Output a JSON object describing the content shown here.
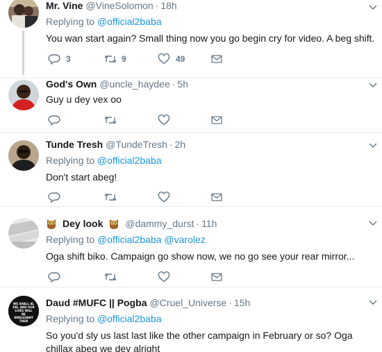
{
  "tweets": [
    {
      "name": "Mr. Vine",
      "handle": "@VineSolomon",
      "time": "18h",
      "replying_label": "Replying to",
      "mentions": [
        "@official2baba"
      ],
      "text": "You wan start again?  Small thing now you go begin cry for video. A beg shift.",
      "reply_count": "3",
      "retweet_count": "9",
      "like_count": "49"
    },
    {
      "name": "God's Own",
      "handle": "@uncle_haydee",
      "time": "5h",
      "text": "Guy u dey vex oo",
      "reply_count": "",
      "retweet_count": "",
      "like_count": ""
    },
    {
      "name": "Tunde Tresh",
      "handle": "@TundeTresh",
      "time": "2h",
      "replying_label": "Replying to",
      "mentions": [
        "@official2baba"
      ],
      "text": "Don't start abeg!",
      "reply_count": "",
      "retweet_count": "",
      "like_count": ""
    },
    {
      "name": "Dey look",
      "handle": "@dammy_durst",
      "time": "11h",
      "replying_label": "Replying to",
      "mentions": [
        "@official2baba",
        "@varolez"
      ],
      "text": "Oga shift biko. Campaign go show now, we no go see your rear mirror...",
      "reply_count": "",
      "retweet_count": "",
      "like_count": ""
    },
    {
      "name": "Daud #MUFC || Pogba",
      "handle": "@Cruel_Universe",
      "time": "15h",
      "replying_label": "Replying to",
      "mentions": [
        "@official2baba"
      ],
      "text": "So you'd sly us last last like the other campaign in February or so? Oga chillax abeg we dey alright",
      "avatar_text": "WE SHALL AL DIE, AND OUR LIVES WILL BE IRRELEVANT THEN",
      "reply_count": "",
      "retweet_count": "",
      "like_count": ""
    }
  ],
  "separator": "·",
  "icons": {
    "reply": "reply-icon",
    "retweet": "retweet-icon",
    "like": "heart-icon",
    "dm": "envelope-icon",
    "more": "chevron-down-icon",
    "owl": "owl-emoji-icon"
  },
  "colors": {
    "link": "#1b95e0",
    "secondary": "#657786",
    "divider": "#e6ecf0",
    "thread_line": "#ccd6dd"
  }
}
